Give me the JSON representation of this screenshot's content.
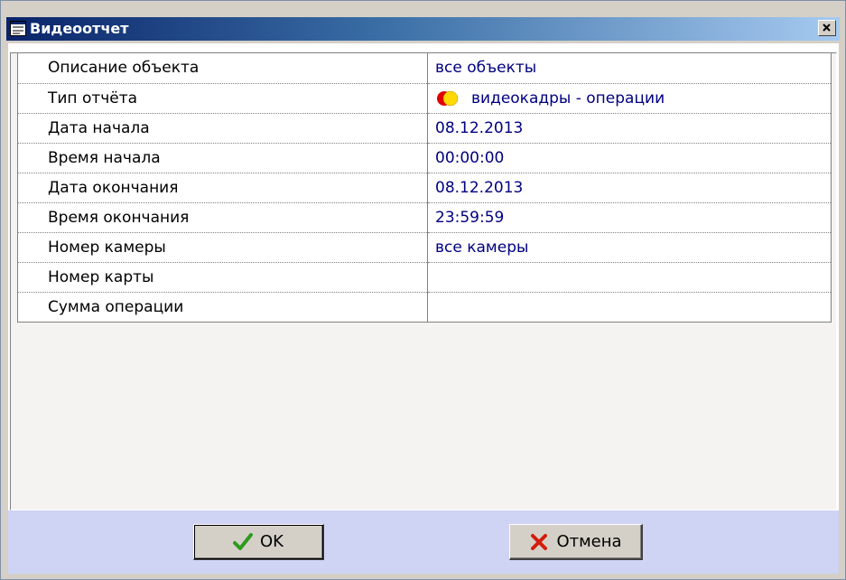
{
  "window": {
    "title": "Видеоотчет",
    "title_icon": "report-window-icon",
    "close_icon": "close-icon"
  },
  "properties": [
    {
      "name": "Описание объекта",
      "value": "все объекты"
    },
    {
      "name": "Тип отчёта",
      "value": "видеокадры - операции",
      "icon": "video-operations-icon"
    },
    {
      "name": "Дата начала",
      "value": "08.12.2013"
    },
    {
      "name": "Время начала",
      "value": "00:00:00"
    },
    {
      "name": "Дата окончания",
      "value": "08.12.2013"
    },
    {
      "name": "Время окончания",
      "value": "23:59:59"
    },
    {
      "name": "Номер камеры",
      "value": "все камеры"
    },
    {
      "name": "Номер карты",
      "value": ""
    },
    {
      "name": "Сумма операции",
      "value": ""
    }
  ],
  "buttons": {
    "ok_label": "OK",
    "ok_icon": "checkmark-icon",
    "cancel_label": "Отмена",
    "cancel_icon": "x-icon"
  },
  "colors": {
    "title_bar_start": "#0a246a",
    "title_bar_end": "#a6caf0",
    "footer_background": "#cfd3f4",
    "value_text": "#000080"
  }
}
